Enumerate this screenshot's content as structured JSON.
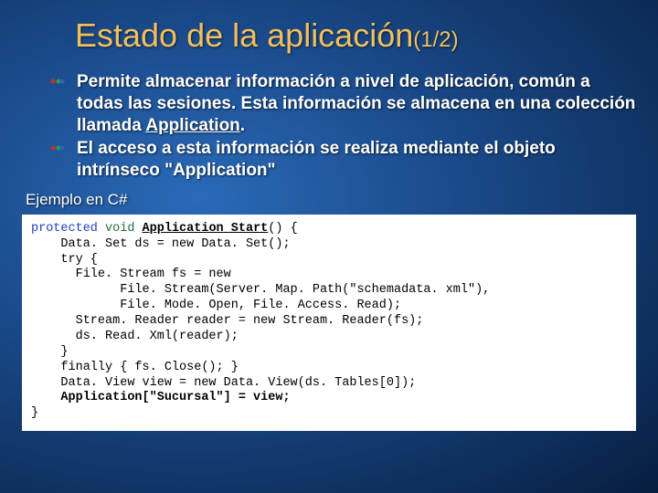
{
  "title": {
    "main": "Estado de la aplicación",
    "suffix": "(1/2)"
  },
  "bullets": [
    {
      "text": "Permite almacenar información a nivel de aplicación, común a todas las sesiones. Esta información se almacena en una colección llamada ",
      "keyword": "Application",
      "tail": "."
    },
    {
      "text": "El acceso a esta información se realiza mediante el objeto intrínseco \"Application\""
    }
  ],
  "subhead": "Ejemplo en C#",
  "code": {
    "l1a": "protected",
    "l1b": "void",
    "l1c": "Application_Start",
    "l1d": "() {",
    "l2": "    Data. Set ds = new Data. Set();",
    "l3": "    try {",
    "l4": "      File. Stream fs = new",
    "l5": "            File. Stream(Server. Map. Path(\"schemadata. xml\"),",
    "l6": "            File. Mode. Open, File. Access. Read);",
    "l7": "      Stream. Reader reader = new Stream. Reader(fs);",
    "l8": "      ds. Read. Xml(reader);",
    "l9": "    }",
    "l10": "    finally { fs. Close(); }",
    "l11": "    Data. View view = new Data. View(ds. Tables[0]);",
    "l12": "    Application[\"Sucursal\"] = view;",
    "l13": "}"
  }
}
